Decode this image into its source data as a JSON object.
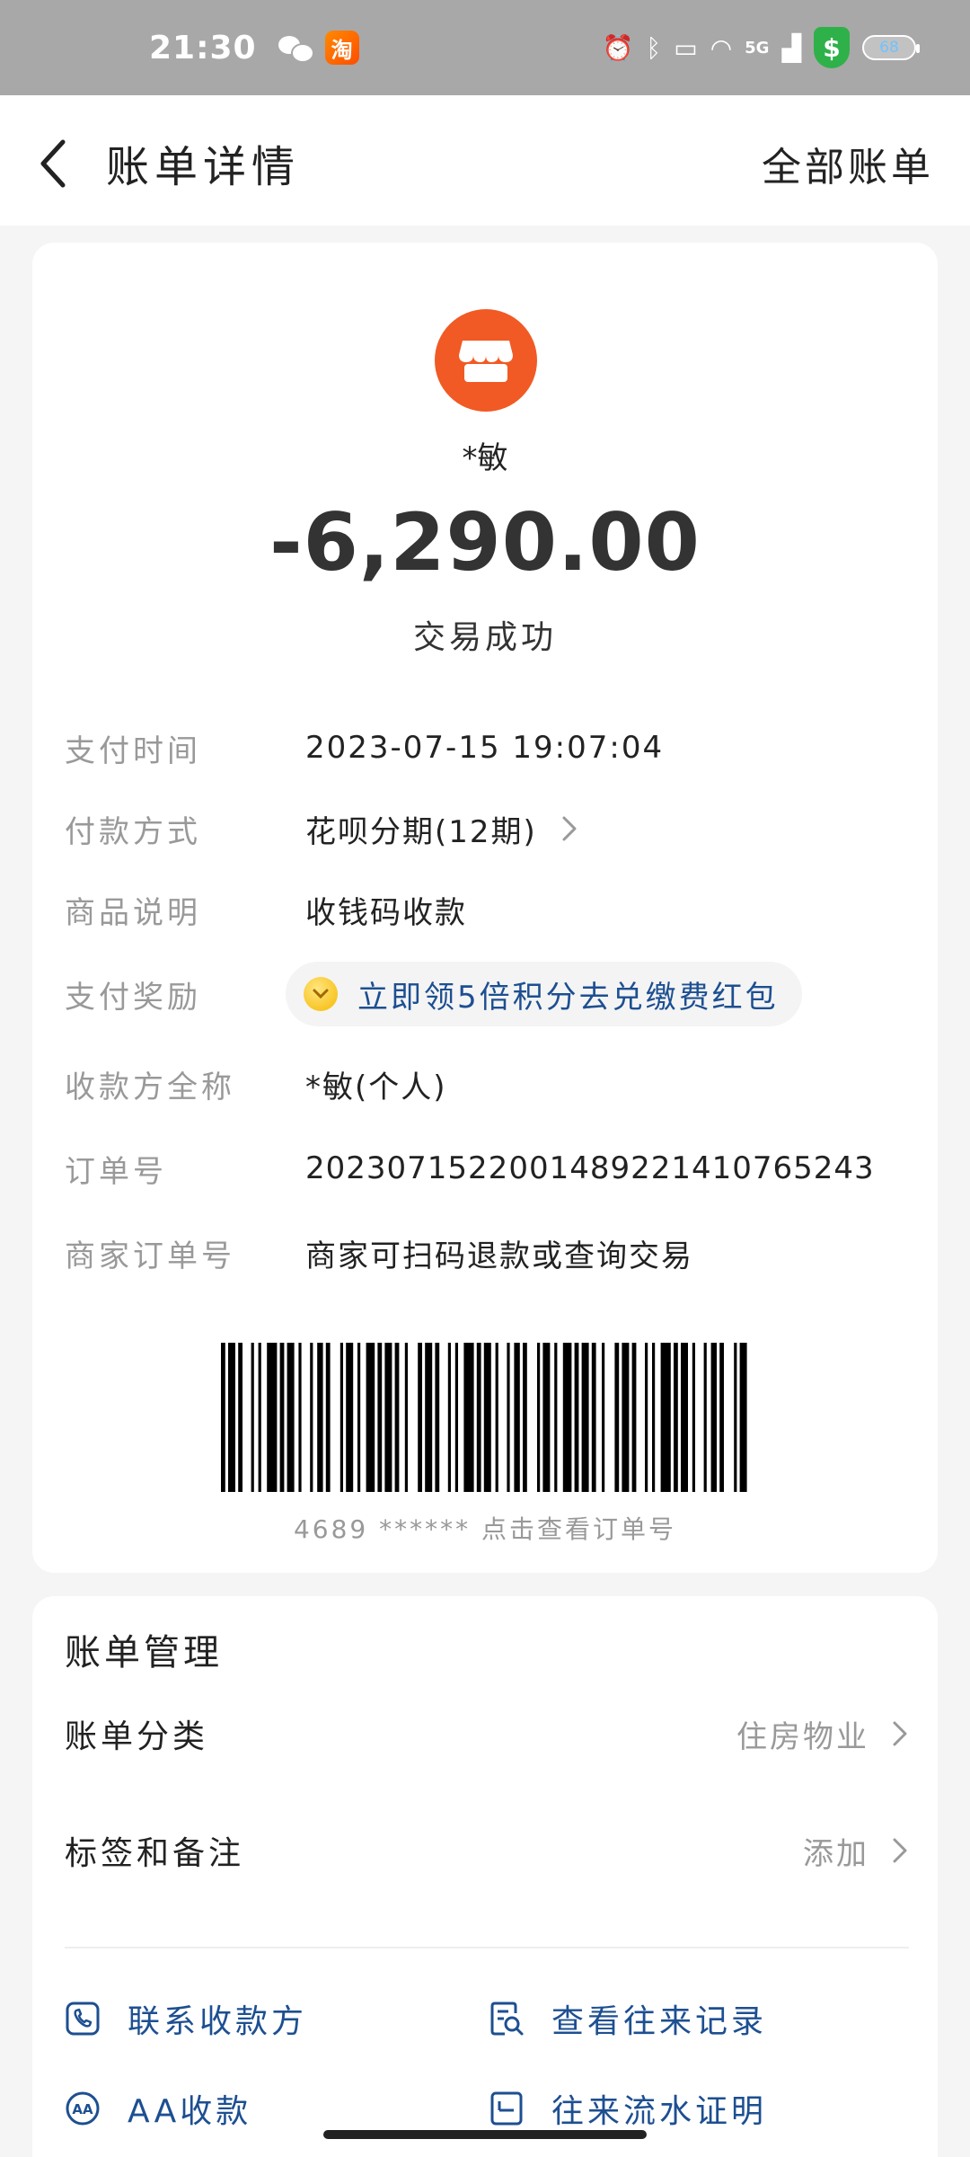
{
  "status_bar": {
    "time": "21:30",
    "network": "5G",
    "battery": "68",
    "icons": [
      "wechat-icon",
      "taobao-icon",
      "alarm-icon",
      "bluetooth-icon",
      "nfc-icon",
      "wifi-icon",
      "signal-icon",
      "shield-icon",
      "battery-icon"
    ]
  },
  "header": {
    "title": "账单详情",
    "all_bills": "全部账单"
  },
  "summary": {
    "payee": "*敏",
    "amount": "-6,290.00",
    "status": "交易成功"
  },
  "details": [
    {
      "label": "支付时间",
      "value": "2023-07-15 19:07:04"
    },
    {
      "label": "付款方式",
      "value": "花呗分期(12期)"
    },
    {
      "label": "商品说明",
      "value": "收钱码收款"
    },
    {
      "label": "支付奖励",
      "value": "立即领5倍积分去兑缴费红包"
    },
    {
      "label": "收款方全称",
      "value": "*敏(个人)"
    },
    {
      "label": "订单号",
      "value": "2023071522001489221410765243"
    },
    {
      "label": "商家订单号",
      "value": "商家可扫码退款或查询交易"
    }
  ],
  "barcode_caption": "4689 ****** 点击查看订单号",
  "manage": {
    "title": "账单管理",
    "category_label": "账单分类",
    "category_value": "住房物业",
    "tags_label": "标签和备注",
    "tags_value": "添加",
    "actions": {
      "contact": "联系收款方",
      "history": "查看往来记录",
      "aa": "AA收款",
      "statement": "往来流水证明"
    }
  },
  "colors": {
    "merchant_logo": "#f15a24",
    "link_blue": "#1d4f91",
    "shield_green": "#2fb14a"
  }
}
